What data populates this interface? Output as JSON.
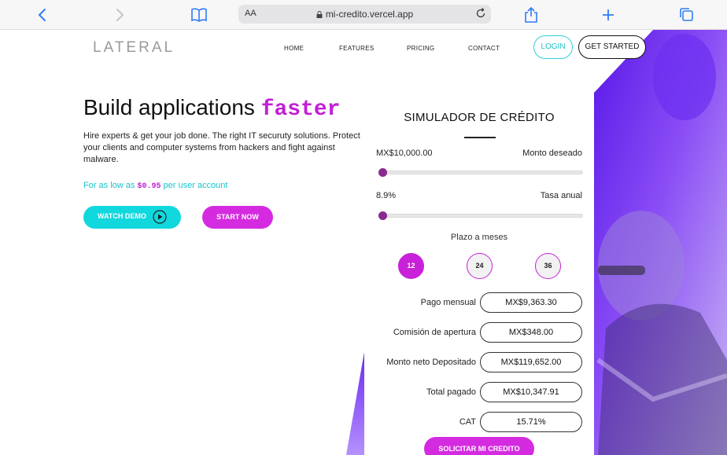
{
  "browser": {
    "text_size_label": "AA",
    "url": "mi-credito.vercel.app"
  },
  "header": {
    "logo": "LATERAL",
    "nav": [
      "HOME",
      "FEATURES",
      "PRICING",
      "CONTACT"
    ],
    "login_label": "LOGIN",
    "get_started_label": "GET STARTED"
  },
  "hero": {
    "title_plain": "Build applications ",
    "title_highlight": "faster",
    "description": "Hire experts & get your job done. The right IT securuty solutions. Protect your clients and computer systems from hackers and fight against malware.",
    "price_prefix": "For as low as ",
    "price_value": "$0.95",
    "price_suffix": " per user account",
    "watch_demo_label": "WATCH DEMO",
    "start_now_label": "START NOW"
  },
  "simulator": {
    "title": "SIMULADOR DE CRÉDITO",
    "amount": {
      "value": "MX$10,000.00",
      "label": "Monto deseado",
      "slider_fraction": 0.0
    },
    "rate": {
      "value": "8.9%",
      "label": "Tasa anual",
      "slider_fraction": 0.0
    },
    "term_label": "Plazo a meses",
    "term_options": [
      "12",
      "24",
      "36"
    ],
    "term_selected": "12",
    "results": [
      {
        "label": "Pago mensual",
        "value": "MX$9,363.30"
      },
      {
        "label": "Comisión de apertura",
        "value": "MX$348.00"
      },
      {
        "label": "Monto neto Depositado",
        "value": "MX$119,652.00"
      },
      {
        "label": "Total pagado",
        "value": "MX$10,347.91"
      },
      {
        "label": "CAT",
        "value": "15.71%"
      }
    ],
    "submit_label": "SOLICITAR MI CREDITO"
  },
  "colors": {
    "accent_magenta": "#d42be0",
    "accent_cyan": "#10d8dd",
    "slider_thumb": "#8a2a8f",
    "hero_purple": "#7a3cf0"
  }
}
